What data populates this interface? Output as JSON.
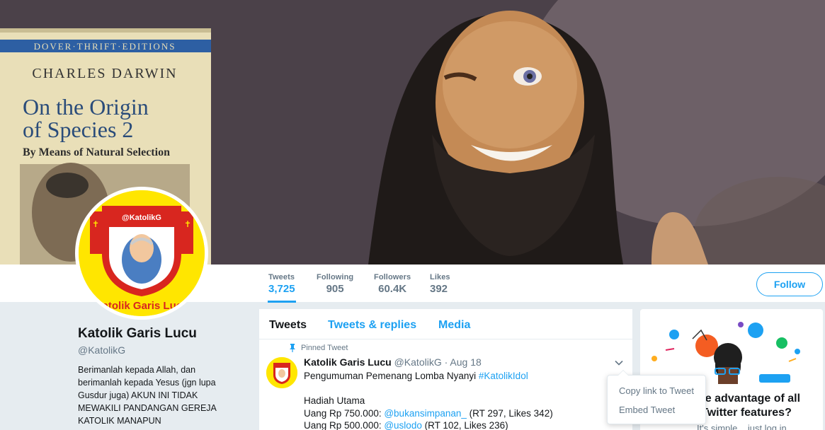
{
  "banner": {
    "book_series": "DOVER·THRIFT·EDITIONS",
    "book_author": "CHARLES DARWIN",
    "book_title_line1": "On the Origin",
    "book_title_line2": "of Species 2",
    "book_subtitle": "By Means of Natural Selection"
  },
  "avatar": {
    "badge_text": "@KatolikG",
    "ring_text": "Katolik Garis Lucu"
  },
  "stats": [
    {
      "label": "Tweets",
      "value": "3,725"
    },
    {
      "label": "Following",
      "value": "905"
    },
    {
      "label": "Followers",
      "value": "60.4K"
    },
    {
      "label": "Likes",
      "value": "392"
    }
  ],
  "follow_label": "Follow",
  "profile": {
    "name": "Katolik Garis Lucu",
    "handle": "@KatolikG",
    "bio": "Berimanlah kepada Allah, dan berimanlah kepada Yesus (jgn lupa Gusdur juga) AKUN INI TIDAK MEWAKILI PANDANGAN GEREJA KATOLIK MANAPUN"
  },
  "tabs": [
    "Tweets",
    "Tweets & replies",
    "Media"
  ],
  "tweet": {
    "pinned_label": "Pinned Tweet",
    "author_name": "Katolik Garis Lucu",
    "author_handle": "@KatolikG",
    "separator": " · ",
    "date": "Aug 18",
    "line1_text": "Pengumuman Pemenang Lomba Nyanyi ",
    "line1_hashtag": "#KatolikIdol",
    "line2": "Hadiah Utama",
    "line3_prefix": "Uang Rp 750.000: ",
    "line3_mention": "@bukansimpanan_",
    "line3_suffix": " (RT 297, Likes 342)",
    "line4_prefix": "Uang Rp 500.000: ",
    "line4_mention": "@uslodo",
    "line4_suffix": " (RT 102, Likes 236)"
  },
  "dropdown": {
    "items": [
      "Copy link to Tweet",
      "Embed Tweet"
    ]
  },
  "promo": {
    "title": "ake advantage of all Twitter features?",
    "subtitle": "It's simple... just log in"
  },
  "colors": {
    "accent": "#1da1f2",
    "muted": "#657786",
    "background": "#e6ecf0",
    "avatar_yellow": "#ffe600",
    "avatar_red": "#d8261f"
  },
  "icons": [
    "pin-icon",
    "chevron-down-icon"
  ]
}
